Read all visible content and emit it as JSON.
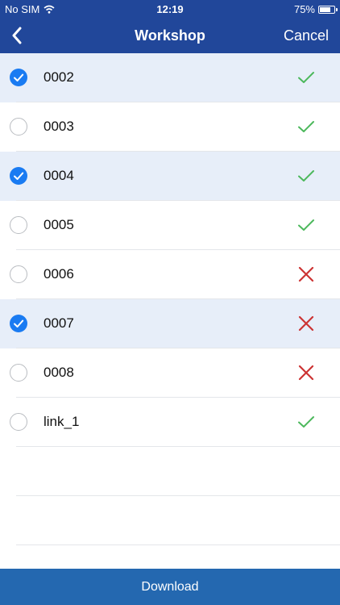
{
  "status_bar": {
    "carrier": "No SIM",
    "time": "12:19",
    "battery": "75%",
    "battery_level": 0.75
  },
  "nav": {
    "title": "Workshop",
    "cancel_label": "Cancel",
    "back_icon": "chevron-left-icon"
  },
  "items": [
    {
      "label": "0002",
      "selected": true,
      "status": "success"
    },
    {
      "label": "0003",
      "selected": false,
      "status": "success"
    },
    {
      "label": "0004",
      "selected": true,
      "status": "success"
    },
    {
      "label": "0005",
      "selected": false,
      "status": "success"
    },
    {
      "label": "0006",
      "selected": false,
      "status": "failure"
    },
    {
      "label": "0007",
      "selected": true,
      "status": "failure"
    },
    {
      "label": "0008",
      "selected": false,
      "status": "failure"
    },
    {
      "label": "link_1",
      "selected": false,
      "status": "success"
    }
  ],
  "footer": {
    "download_label": "Download"
  },
  "colors": {
    "nav_bg": "#21479a",
    "selected_row_bg": "#e7eef9",
    "check_blue": "#1a7bf2",
    "success_green": "#4cb85c",
    "failure_red": "#cc3333",
    "download_bg": "#2468b0"
  }
}
